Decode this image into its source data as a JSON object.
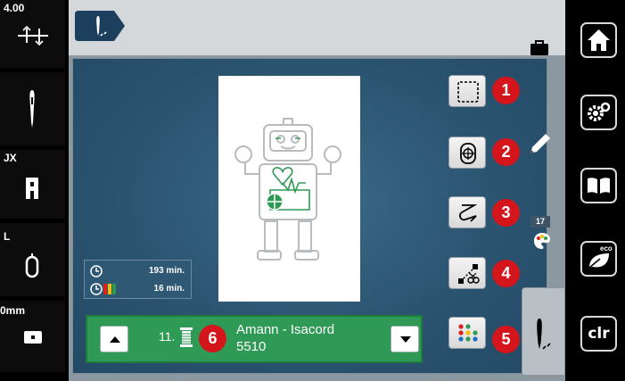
{
  "left_bar": {
    "stitch_width": "4.00",
    "presser_foot": "JX",
    "needle_label": "L",
    "thread_tension": "0mm"
  },
  "top_bar": {
    "mode_icon": "embroidery-needle-icon",
    "right_icon": "briefcase-icon"
  },
  "stitch_info": {
    "total_time": "193 min.",
    "color_time": "16 min."
  },
  "color_selector": {
    "index": "11.",
    "thread_brand": "Amann - Isacord",
    "thread_number": "5510"
  },
  "function_buttons": [
    {
      "badge": "1",
      "icon": "hoop-outline-icon"
    },
    {
      "badge": "2",
      "icon": "center-position-icon"
    },
    {
      "badge": "3",
      "icon": "edit-stitch-icon"
    },
    {
      "badge": "4",
      "icon": "cut-jump-stitch-icon"
    },
    {
      "badge": "5",
      "icon": "color-dots-icon"
    },
    {
      "badge": "6",
      "icon": "spool-icon"
    }
  ],
  "color_count": "17",
  "right_bar": {
    "home": "home-icon",
    "settings": "settings-icon",
    "guide": "book-icon",
    "eco": "eco-icon",
    "clr_label": "clr"
  },
  "colors": {
    "screen_bg": "#8c98a1",
    "panel_bg": "#2b5471",
    "color_bar": "#2f9a55",
    "badge": "#d4151c"
  }
}
